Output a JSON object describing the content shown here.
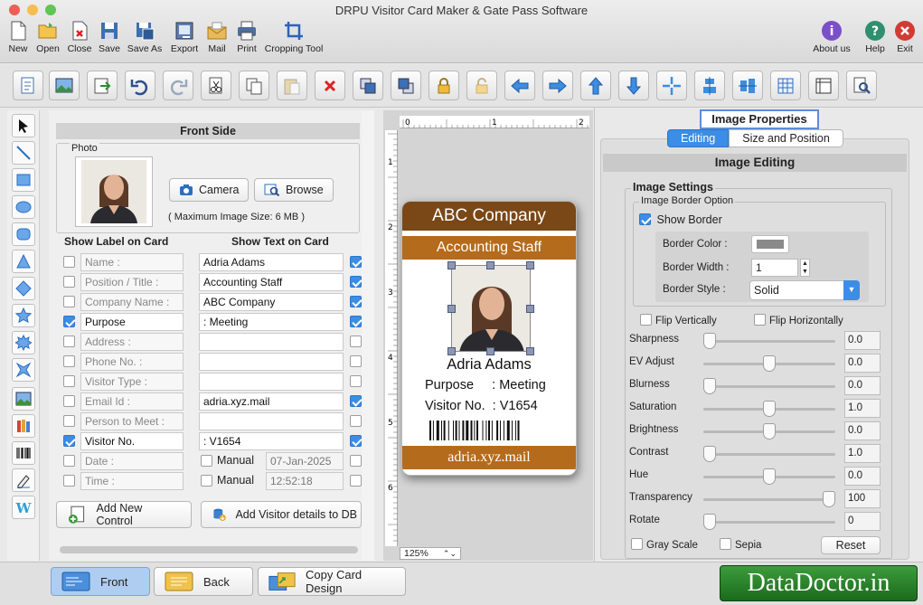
{
  "window": {
    "title": "DRPU Visitor Card Maker & Gate Pass Software"
  },
  "toolbar": {
    "left": [
      {
        "label": "New",
        "icon": "new-document-icon"
      },
      {
        "label": "Open",
        "icon": "open-folder-icon"
      },
      {
        "label": "Close",
        "icon": "close-document-icon"
      },
      {
        "label": "Save",
        "icon": "save-icon"
      },
      {
        "label": "Save As",
        "icon": "save-as-icon"
      },
      {
        "label": "Export",
        "icon": "export-icon"
      },
      {
        "label": "Mail",
        "icon": "mail-icon"
      },
      {
        "label": "Print",
        "icon": "print-icon"
      },
      {
        "label": "Cropping Tool",
        "icon": "crop-icon"
      }
    ],
    "right": [
      {
        "label": "About us",
        "icon": "about-icon"
      },
      {
        "label": "Help",
        "icon": "help-icon"
      },
      {
        "label": "Exit",
        "icon": "exit-icon"
      }
    ]
  },
  "front_side": {
    "header": "Front Side",
    "photo_legend": "Photo",
    "camera_label": "Camera",
    "browse_label": "Browse",
    "max_size": "( Maximum Image Size: 6 MB )",
    "show_label_header": "Show Label on Card",
    "show_text_header": "Show Text on Card",
    "rows": [
      {
        "label": "Name :",
        "label_on": false,
        "text": "Adria Adams",
        "text_on": true
      },
      {
        "label": "Position / Title :",
        "label_on": false,
        "text": "Accounting Staff",
        "text_on": true
      },
      {
        "label": "Company Name :",
        "label_on": false,
        "text": "ABC Company",
        "text_on": true
      },
      {
        "label": "Purpose",
        "label_on": true,
        "text": ": Meeting",
        "text_on": true
      },
      {
        "label": "Address :",
        "label_on": false,
        "text": "",
        "text_on": false
      },
      {
        "label": "Phone No. :",
        "label_on": false,
        "text": "",
        "text_on": false
      },
      {
        "label": "Visitor Type :",
        "label_on": false,
        "text": "",
        "text_on": false
      },
      {
        "label": "Email Id :",
        "label_on": false,
        "text": "adria.xyz.mail",
        "text_on": true
      },
      {
        "label": "Person to Meet :",
        "label_on": false,
        "text": "",
        "text_on": false
      },
      {
        "label": "Visitor No.",
        "label_on": true,
        "text": ": V1654",
        "text_on": true
      },
      {
        "label": "Date :",
        "label_on": false,
        "manual": "Manual",
        "value": "07-Jan-2025",
        "text_on": false
      },
      {
        "label": "Time :",
        "label_on": false,
        "manual": "Manual",
        "value": "12:52:18",
        "text_on": false
      }
    ],
    "add_control_label": "Add New Control",
    "add_db_label": "Add Visitor details to DB"
  },
  "canvas": {
    "zoom": "125%",
    "ruler_top": [
      "0",
      "1",
      "2"
    ],
    "ruler_left": [
      "1",
      "2",
      "3",
      "4",
      "5",
      "6"
    ]
  },
  "card": {
    "company": "ABC Company",
    "department": "Accounting Staff",
    "name": "Adria Adams",
    "purpose": "Purpose     : Meeting",
    "visitor": "Visitor No.  : V1654",
    "email": "adria.xyz.mail",
    "header_color": "#7a4717",
    "band_color": "#b46b1c"
  },
  "image_properties": {
    "title": "Image Properties",
    "tab_editing": "Editing",
    "tab_size": "Size and Position",
    "header": "Image Editing",
    "settings_legend": "Image Settings",
    "border_legend": "Image Border Option",
    "show_border_label": "Show Border",
    "show_border": true,
    "border_color_label": "Border Color :",
    "border_width_label": "Border Width :",
    "border_width_value": "1",
    "border_style_label": "Border Style :",
    "border_style_value": "Solid",
    "flip_v_label": "Flip Vertically",
    "flip_h_label": "Flip Horizontally",
    "sliders": [
      {
        "label": "Sharpness",
        "value": "0.0",
        "pos": 0.0
      },
      {
        "label": "EV Adjust",
        "value": "0.0",
        "pos": 0.5
      },
      {
        "label": "Blurness",
        "value": "0.0",
        "pos": 0.0
      },
      {
        "label": "Saturation",
        "value": "1.0",
        "pos": 0.5
      },
      {
        "label": "Brightness",
        "value": "0.0",
        "pos": 0.5
      },
      {
        "label": "Contrast",
        "value": "1.0",
        "pos": 0.0
      },
      {
        "label": "Hue",
        "value": "0.0",
        "pos": 0.5
      },
      {
        "label": "Transparency",
        "value": "100",
        "pos": 1.0
      },
      {
        "label": "Rotate",
        "value": "0",
        "pos": 0.0
      }
    ],
    "grayscale_label": "Gray Scale",
    "sepia_label": "Sepia",
    "reset_label": "Reset"
  },
  "bottom": {
    "front_label": "Front",
    "back_label": "Back",
    "copy_label": "Copy Card Design"
  },
  "watermark": "DataDoctor.in"
}
